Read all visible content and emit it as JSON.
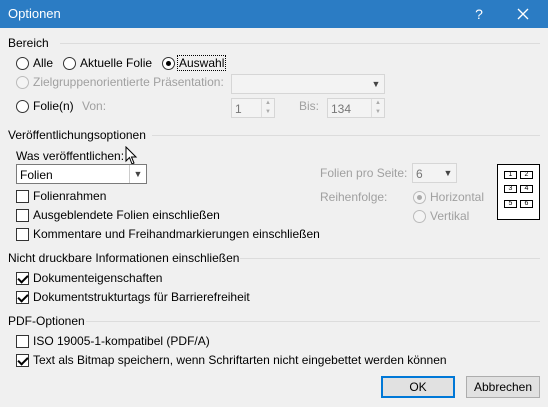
{
  "window": {
    "title": "Optionen",
    "help": "?",
    "close": "✕"
  },
  "bereich": {
    "heading": "Bereich",
    "alle": "Alle",
    "aktuelle_folie": "Aktuelle Folie",
    "auswahl": "Auswahl",
    "zielgruppe": "Zielgruppenorientierte Präsentation:",
    "folien": "Folie(n)",
    "von_label": "Von:",
    "von_value": "1",
    "bis_label": "Bis:",
    "bis_value": "134"
  },
  "veroeffentlichung": {
    "heading": "Veröffentlichungsoptionen",
    "was_label": "Was veröffentlichen:",
    "was_value": "Folien",
    "folien_pro_seite_label": "Folien pro Seite:",
    "folien_pro_seite_value": "6",
    "reihenfolge_label": "Reihenfolge:",
    "horizontal": "Horizontal",
    "vertikal": "Vertikal",
    "folienrahmen": "Folienrahmen",
    "ausgeblendete": "Ausgeblendete Folien einschließen",
    "kommentare": "Kommentare und Freihandmarkierungen einschließen",
    "layout_cells": [
      "1",
      "2",
      "3",
      "4",
      "5",
      "6"
    ]
  },
  "nicht_druckbar": {
    "heading": "Nicht druckbare Informationen einschließen",
    "dokumenteigenschaften": "Dokumenteigenschaften",
    "strukturtags": "Dokumentstrukturtags für Barrierefreiheit"
  },
  "pdf": {
    "heading": "PDF-Optionen",
    "iso": "ISO 19005-1-kompatibel (PDF/A)",
    "bitmap": "Text als Bitmap speichern, wenn Schriftarten nicht eingebettet werden können"
  },
  "buttons": {
    "ok": "OK",
    "cancel": "Abbrechen"
  },
  "colors": {
    "titlebar": "#2b7cc4",
    "accent": "#0078d7"
  }
}
